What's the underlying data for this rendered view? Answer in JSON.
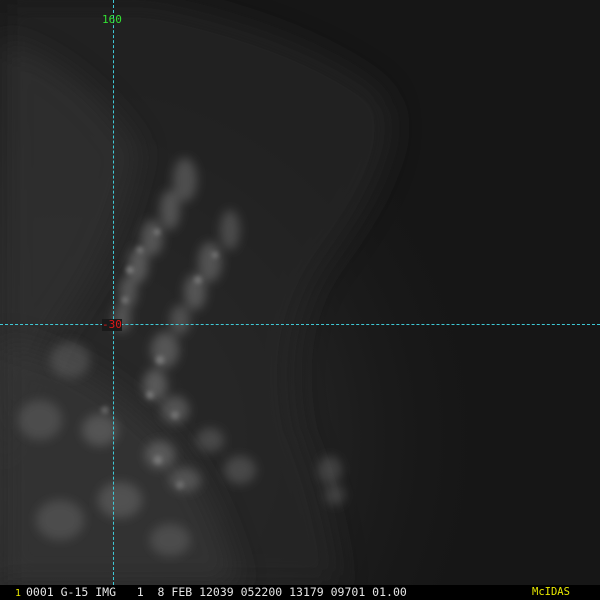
{
  "image": {
    "type": "satellite imagery",
    "colors": {
      "background": "#161616",
      "cloud_bright": "#8a8a8a",
      "haze": "#3a3a3a",
      "grid_line": "#3fc9d6"
    }
  },
  "grid": {
    "longitude_label": "160",
    "latitude_label": "-30",
    "longitude_label_color": "#33e033",
    "latitude_label_color": "#e01818"
  },
  "status_bar": {
    "frame_number": "1",
    "text": "0001 G-15 IMG   1  8 FEB 12039 052200 13179 09701 01.00",
    "logo": "McIDAS",
    "frame_color": "#e8e800",
    "text_color": "#e6e6e6",
    "logo_color": "#e8e800"
  }
}
